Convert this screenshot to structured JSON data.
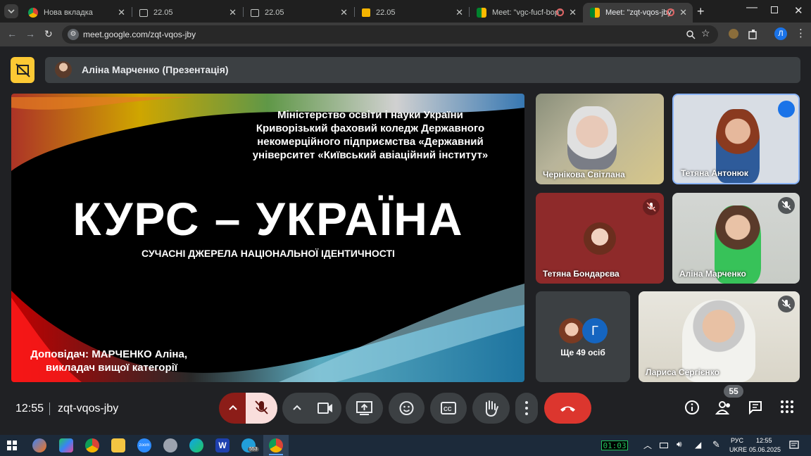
{
  "browser": {
    "tabs": [
      {
        "title": "Нова вкладка",
        "active": false
      },
      {
        "title": "22.05",
        "active": false
      },
      {
        "title": "22.05",
        "active": false
      },
      {
        "title": "22.05",
        "active": false
      },
      {
        "title": "Meet: \"vgc-fucf-bop\"",
        "active": false
      },
      {
        "title": "Meet: \"zqt-vqos-jby\"",
        "active": true
      }
    ],
    "url": "meet.google.com/zqt-vqos-jby",
    "profile_initial": "Л"
  },
  "meet": {
    "presenter_label": "Аліна Марченко (Презентація)",
    "slide": {
      "org_line1": "Міністерство освіти і науки України",
      "org_line2": "Криворізький фаховий коледж Державного",
      "org_line3": "некомерційного підприємства «Державний",
      "org_line4": "університет «Київський авіаційний інститут»",
      "title": "КУРС – УКРАЇНА",
      "subtitle": "СУЧАСНІ ДЖЕРЕЛА НАЦІОНАЛЬНОЇ ІДЕНТИЧНОСТІ",
      "speaker_line1": "Доповідач: МАРЧЕНКО Аліна,",
      "speaker_line2": "викладач вищої категорії"
    },
    "participants": [
      {
        "name": "Чернікова Світлана",
        "muted": false
      },
      {
        "name": "Тетяна Антонюк",
        "muted": false,
        "speaking": true
      },
      {
        "name": "Тетяна Бондарєва",
        "muted": true
      },
      {
        "name": "Аліна Марченко",
        "muted": true
      },
      {
        "name": "Лариса Сергієнко",
        "muted": true
      }
    ],
    "others": {
      "label": "Ще 49 осіб",
      "avatar_letter": "Г"
    },
    "time": "12:55",
    "meeting_code": "zqt-vqos-jby",
    "participant_count": "55"
  },
  "taskbar": {
    "timer": "01:03",
    "lang": "РУС",
    "lang2": "UKRE",
    "clock_time": "12:55",
    "clock_date": "05.06.2025",
    "telegram_badge": "553"
  }
}
